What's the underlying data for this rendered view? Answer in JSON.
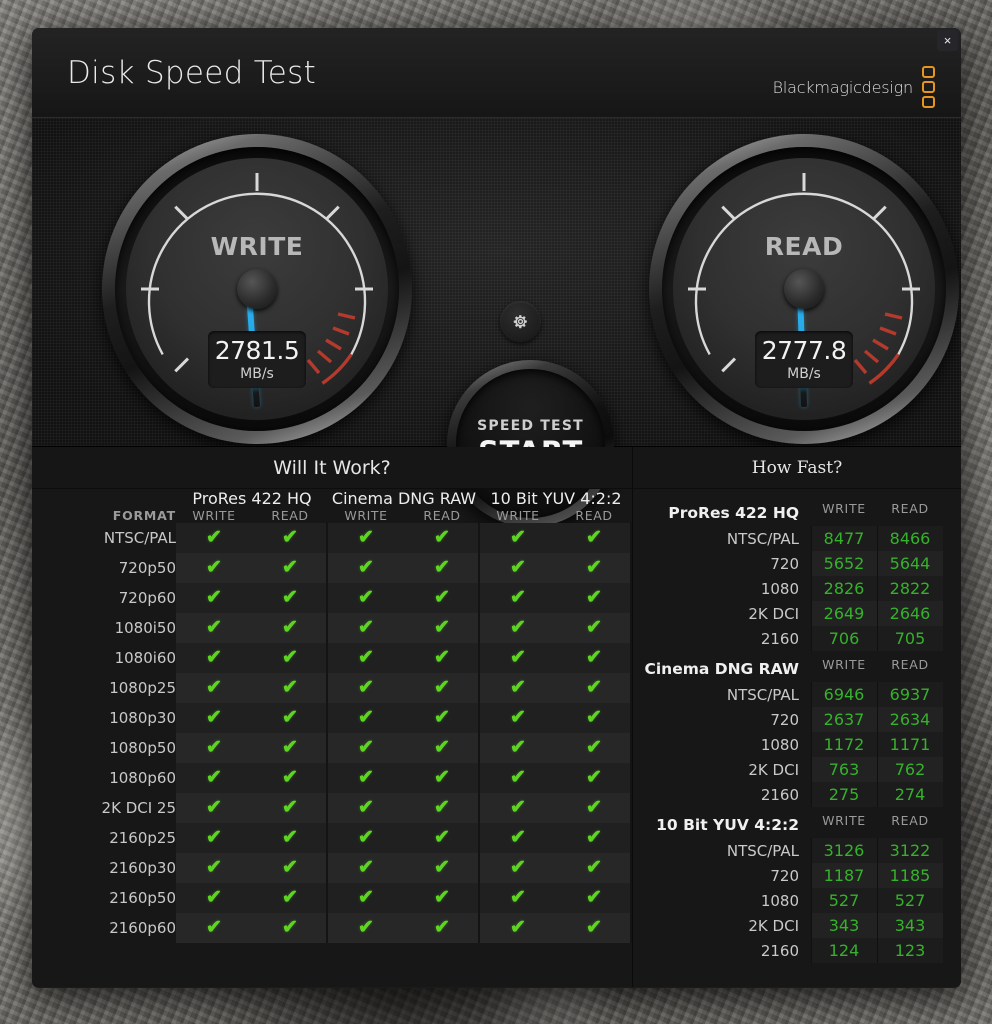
{
  "window": {
    "title": "Disk Speed Test",
    "brand": "Blackmagicdesign",
    "close_label": "×"
  },
  "gauges": {
    "write": {
      "label": "WRITE",
      "value": "2781.5",
      "unit": "MB/s",
      "needle_deg": -4
    },
    "read": {
      "label": "READ",
      "value": "2777.8",
      "unit": "MB/s",
      "needle_deg": -2
    }
  },
  "center": {
    "gear_icon": "gear-icon",
    "start_sub": "SPEED TEST",
    "start_main": "START"
  },
  "will_it_work": {
    "title": "Will It Work?",
    "format_header": "FORMAT",
    "codecs": [
      "ProRes 422 HQ",
      "Cinema DNG RAW",
      "10 Bit YUV 4:2:2"
    ],
    "sub_headers": [
      "WRITE",
      "READ"
    ],
    "check_glyph": "✔",
    "formats": [
      "NTSC/PAL",
      "720p50",
      "720p60",
      "1080i50",
      "1080i60",
      "1080p25",
      "1080p30",
      "1080p50",
      "1080p60",
      "2K DCI 25",
      "2160p25",
      "2160p30",
      "2160p50",
      "2160p60"
    ],
    "results": [
      [
        true,
        true,
        true,
        true,
        true,
        true
      ],
      [
        true,
        true,
        true,
        true,
        true,
        true
      ],
      [
        true,
        true,
        true,
        true,
        true,
        true
      ],
      [
        true,
        true,
        true,
        true,
        true,
        true
      ],
      [
        true,
        true,
        true,
        true,
        true,
        true
      ],
      [
        true,
        true,
        true,
        true,
        true,
        true
      ],
      [
        true,
        true,
        true,
        true,
        true,
        true
      ],
      [
        true,
        true,
        true,
        true,
        true,
        true
      ],
      [
        true,
        true,
        true,
        true,
        true,
        true
      ],
      [
        true,
        true,
        true,
        true,
        true,
        true
      ],
      [
        true,
        true,
        true,
        true,
        true,
        true
      ],
      [
        true,
        true,
        true,
        true,
        true,
        true
      ],
      [
        true,
        true,
        true,
        true,
        true,
        true
      ],
      [
        true,
        true,
        true,
        true,
        true,
        true
      ]
    ]
  },
  "how_fast": {
    "title": "How Fast?",
    "sub_headers": [
      "WRITE",
      "READ"
    ],
    "sections": [
      {
        "codec": "ProRes 422 HQ",
        "rows": [
          {
            "res": "NTSC/PAL",
            "write": "8477",
            "read": "8466"
          },
          {
            "res": "720",
            "write": "5652",
            "read": "5644"
          },
          {
            "res": "1080",
            "write": "2826",
            "read": "2822"
          },
          {
            "res": "2K DCI",
            "write": "2649",
            "read": "2646"
          },
          {
            "res": "2160",
            "write": "706",
            "read": "705"
          }
        ]
      },
      {
        "codec": "Cinema DNG RAW",
        "rows": [
          {
            "res": "NTSC/PAL",
            "write": "6946",
            "read": "6937"
          },
          {
            "res": "720",
            "write": "2637",
            "read": "2634"
          },
          {
            "res": "1080",
            "write": "1172",
            "read": "1171"
          },
          {
            "res": "2K DCI",
            "write": "763",
            "read": "762"
          },
          {
            "res": "2160",
            "write": "275",
            "read": "274"
          }
        ]
      },
      {
        "codec": "10 Bit YUV 4:2:2",
        "rows": [
          {
            "res": "NTSC/PAL",
            "write": "3126",
            "read": "3122"
          },
          {
            "res": "720",
            "write": "1187",
            "read": "1185"
          },
          {
            "res": "1080",
            "write": "527",
            "read": "527"
          },
          {
            "res": "2K DCI",
            "write": "343",
            "read": "343"
          },
          {
            "res": "2160",
            "write": "124",
            "read": "123"
          }
        ]
      }
    ]
  },
  "colors": {
    "needle": "#2fb4ef",
    "check": "#5dd422",
    "value_green": "#36b12c",
    "brand_orange": "#e8941f",
    "redzone": "#b33a2c"
  }
}
